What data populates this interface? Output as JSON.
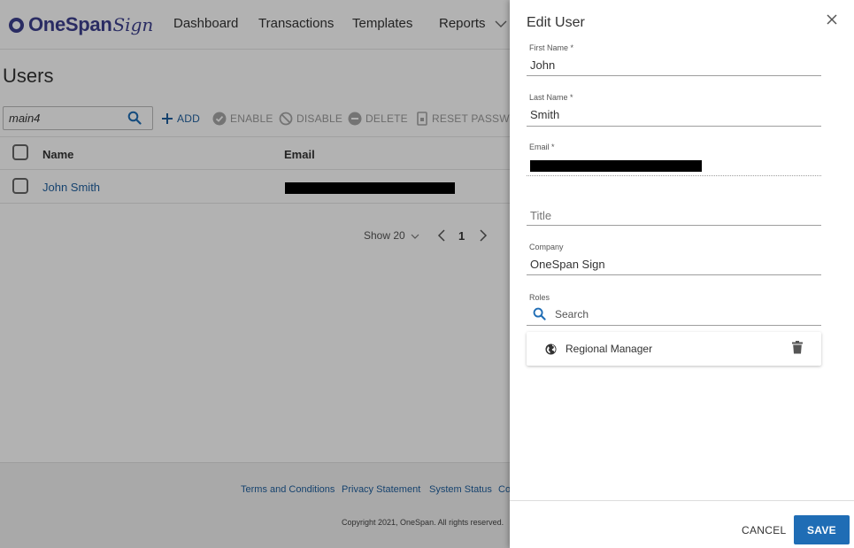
{
  "header": {
    "logo_text": "OneSpan",
    "logo_script": "Sign",
    "nav": [
      "Dashboard",
      "Transactions",
      "Templates",
      "Reports"
    ]
  },
  "users_page": {
    "title": "Users",
    "search_value": "main4",
    "toolbar": {
      "add": "ADD",
      "enable": "ENABLE",
      "disable": "DISABLE",
      "delete": "DELETE",
      "reset_password": "RESET PASSWORD"
    },
    "columns": {
      "name": "Name",
      "email": "Email"
    },
    "rows": [
      {
        "name": "John Smith"
      }
    ],
    "pagination": {
      "show": "Show 20",
      "page": "1"
    }
  },
  "footer": {
    "links": [
      "Terms and Conditions",
      "Privacy Statement",
      "System Status",
      "Co"
    ],
    "copyright": "Copyright 2021, OneSpan. All rights reserved."
  },
  "drawer": {
    "title": "Edit User",
    "fields": {
      "first_name": {
        "label": "First Name *",
        "value": "John"
      },
      "last_name": {
        "label": "Last Name *",
        "value": "Smith"
      },
      "email": {
        "label": "Email *"
      },
      "title": {
        "placeholder": "Title"
      },
      "company": {
        "label": "Company",
        "value": "OneSpan Sign"
      }
    },
    "roles": {
      "label": "Roles",
      "search_placeholder": "Search",
      "items": [
        {
          "name": "Regional Manager"
        }
      ]
    },
    "cancel_label": "CANCEL",
    "save_label": "SAVE"
  },
  "colors": {
    "brand": "#3d3f8e",
    "link": "#1f5f9e",
    "primary_button": "#1f6db5"
  }
}
